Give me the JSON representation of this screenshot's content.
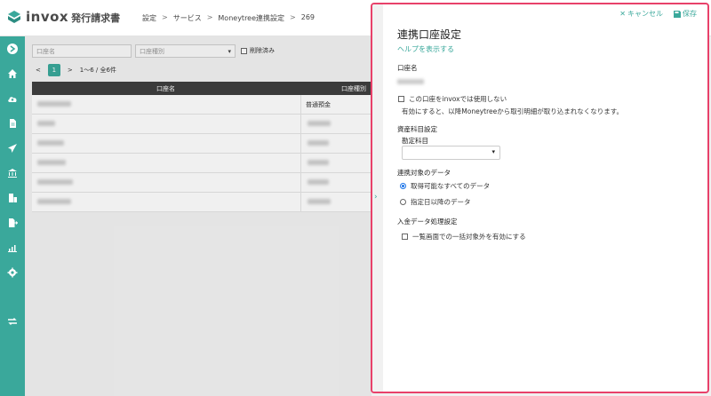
{
  "app": {
    "logo_text": "invox",
    "logo_sub": "発行請求書"
  },
  "breadcrumb": [
    "設定",
    "サービス",
    "Moneytree連携設定",
    "269"
  ],
  "breadcrumb_sep": ">",
  "sidebar": {
    "icons": [
      "arrow-right-circle-icon",
      "home-icon",
      "cloud-upload-icon",
      "document-icon",
      "send-icon",
      "bank-icon",
      "building-icon",
      "file-export-icon",
      "chart-icon",
      "gear-icon",
      "transfer-icon"
    ]
  },
  "main": {
    "filters": {
      "account_name_placeholder": "口座名",
      "account_type_placeholder": "口座種別",
      "deleted_label": "削除済み"
    },
    "pager": {
      "prev": "<",
      "page": "1",
      "next": ">",
      "summary": "1〜6 / 全6件"
    },
    "table": {
      "headers": [
        "口座名",
        "口座種別"
      ],
      "rows": [
        {
          "type": "普通預金"
        },
        {
          "type": ""
        },
        {
          "type": ""
        },
        {
          "type": ""
        },
        {
          "type": ""
        },
        {
          "type": ""
        }
      ]
    }
  },
  "panel": {
    "cancel_label": "キャンセル",
    "save_label": "保存",
    "title": "連携口座設定",
    "help_link": "ヘルプを表示する",
    "account_name_label": "口座名",
    "unused_checkbox_label": "この口座をinvoxでは使用しない",
    "unused_note": "有効にすると、以降Moneytreeから取引明細が取り込まれなくなります。",
    "asset_section_label": "資産科目設定",
    "account_title_label": "勘定科目",
    "target_section_label": "連携対象のデータ",
    "radio_all": "取得可能なすべてのデータ",
    "radio_after_date": "指定日以降のデータ",
    "deposit_section_label": "入金データ処理設定",
    "exclude_checkbox_label": "一覧画面での一括対象外を有効にする"
  },
  "colors": {
    "accent": "#3aa89b",
    "highlight_border": "#e8416a",
    "radio": "#1a73e8"
  }
}
